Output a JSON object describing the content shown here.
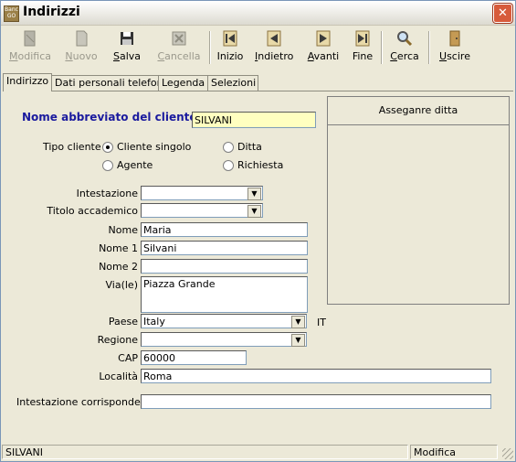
{
  "window": {
    "title": "Indirizzi",
    "app_icon_text": "Banc GO"
  },
  "toolbar": {
    "modifica": "Modifica",
    "nuovo": "Nuovo",
    "salva": "Salva",
    "cancella": "Cancella",
    "inizio": "Inizio",
    "indietro": "Indietro",
    "avanti": "Avanti",
    "fine": "Fine",
    "cerca": "Cerca",
    "uscire": "Uscire"
  },
  "tabs": [
    "Indirizzo",
    "Dati personali telefono",
    "Legenda",
    "Selezioni"
  ],
  "form": {
    "heading": "Nome abbreviato del cliente",
    "short_name": "SILVANI",
    "tipo_cliente_label": "Tipo cliente",
    "radio_cliente_singolo": "Cliente singolo",
    "radio_agente": "Agente",
    "radio_ditta": "Ditta",
    "radio_richiesta": "Richiesta",
    "intestazione_label": "Intestazione",
    "intestazione_value": "",
    "titolo_label": "Titolo accademico",
    "titolo_value": "",
    "nome_label": "Nome",
    "nome_value": "Maria",
    "nome1_label": "Nome 1",
    "nome1_value": "Silvani",
    "nome2_label": "Nome 2",
    "nome2_value": "",
    "via_label": "Via(le)",
    "via_value": "Piazza Grande",
    "paese_label": "Paese",
    "paese_value": "Italy",
    "paese_code": "IT",
    "regione_label": "Regione",
    "regione_value": "",
    "cap_label": "CAP",
    "cap_value": "60000",
    "localita_label": "Località",
    "localita_value": "Roma",
    "corrispondenza_label": "Intestazione corrispondenza",
    "corrispondenza_value": ""
  },
  "assign_panel": {
    "title": "Asseganre ditta"
  },
  "statusbar": {
    "record": "SILVANI",
    "mode": "Modifica"
  }
}
